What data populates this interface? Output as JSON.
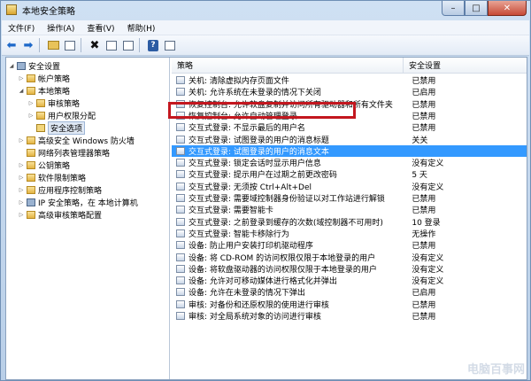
{
  "window": {
    "title": "本地安全策略",
    "controls": {
      "min": "–",
      "max": "□",
      "close": "✕"
    }
  },
  "menu": {
    "items": [
      "文件(F)",
      "操作(A)",
      "查看(V)",
      "帮助(H)"
    ]
  },
  "toolbar": {
    "icons": [
      "back-arrow-icon",
      "forward-arrow-icon",
      "folder-up-icon",
      "show-tree-icon",
      "delete-icon",
      "properties-icon",
      "export-icon",
      "help-icon",
      "view-icon"
    ],
    "help_glyph": "?"
  },
  "tree": {
    "items": [
      {
        "label": "安全设置",
        "level": 0,
        "expander": "◢",
        "icon": "computer-icon"
      },
      {
        "label": "帐户策略",
        "level": 1,
        "expander": "▷",
        "icon": "folder-icon"
      },
      {
        "label": "本地策略",
        "level": 1,
        "expander": "◢",
        "icon": "folder-icon"
      },
      {
        "label": "审核策略",
        "level": 2,
        "expander": "▷",
        "icon": "folder-icon"
      },
      {
        "label": "用户权限分配",
        "level": 2,
        "expander": "▷",
        "icon": "folder-icon"
      },
      {
        "label": "安全选项",
        "level": 2,
        "expander": "",
        "icon": "folder-open-icon",
        "selected": true
      },
      {
        "label": "高级安全 Windows 防火墙",
        "level": 1,
        "expander": "▷",
        "icon": "folder-icon"
      },
      {
        "label": "网络列表管理器策略",
        "level": 1,
        "expander": "",
        "icon": "folder-icon"
      },
      {
        "label": "公钥策略",
        "level": 1,
        "expander": "▷",
        "icon": "folder-icon"
      },
      {
        "label": "软件限制策略",
        "level": 1,
        "expander": "▷",
        "icon": "folder-icon"
      },
      {
        "label": "应用程序控制策略",
        "level": 1,
        "expander": "▷",
        "icon": "folder-icon"
      },
      {
        "label": "IP 安全策略，在 本地计算机",
        "level": 1,
        "expander": "▷",
        "icon": "computer-icon"
      },
      {
        "label": "高级审核策略配置",
        "level": 1,
        "expander": "▷",
        "icon": "folder-icon"
      }
    ]
  },
  "list": {
    "columns": [
      "策略",
      "安全设置"
    ],
    "rows": [
      {
        "policy": "关机: 清除虚拟内存页面文件",
        "setting": "已禁用"
      },
      {
        "policy": "关机: 允许系统在未登录的情况下关闭",
        "setting": "已启用"
      },
      {
        "policy": "恢复控制台: 允许软盘复制并访问所有驱动器和所有文件夹",
        "setting": "已禁用"
      },
      {
        "policy": "恢复控制台: 允许自动管理登录",
        "setting": "已禁用"
      },
      {
        "policy": "交互式登录: 不显示最后的用户名",
        "setting": "已禁用"
      },
      {
        "policy": "交互式登录: 试图登录的用户的消息标题",
        "setting": "关关"
      },
      {
        "policy": "交互式登录: 试图登录的用户的消息文本",
        "setting": "",
        "selected": true
      },
      {
        "policy": "交互式登录: 锁定会话时显示用户信息",
        "setting": "没有定义"
      },
      {
        "policy": "交互式登录: 提示用户在过期之前更改密码",
        "setting": "5 天"
      },
      {
        "policy": "交互式登录: 无须按 Ctrl+Alt+Del",
        "setting": "没有定义"
      },
      {
        "policy": "交互式登录: 需要域控制器身份验证以对工作站进行解锁",
        "setting": "已禁用"
      },
      {
        "policy": "交互式登录: 需要智能卡",
        "setting": "已禁用"
      },
      {
        "policy": "交互式登录: 之前登录到缓存的次数(域控制器不可用时)",
        "setting": "10 登录"
      },
      {
        "policy": "交互式登录: 智能卡移除行为",
        "setting": "无操作"
      },
      {
        "policy": "设备: 防止用户安装打印机驱动程序",
        "setting": "已禁用"
      },
      {
        "policy": "设备: 将 CD-ROM 的访问权限仅限于本地登录的用户",
        "setting": "没有定义"
      },
      {
        "policy": "设备: 将软盘驱动器的访问权限仅限于本地登录的用户",
        "setting": "没有定义"
      },
      {
        "policy": "设备: 允许对可移动媒体进行格式化并弹出",
        "setting": "没有定义"
      },
      {
        "policy": "设备: 允许在未登录的情况下弹出",
        "setting": "已启用"
      },
      {
        "policy": "审核: 对备份和还原权限的使用进行审核",
        "setting": "已禁用"
      },
      {
        "policy": "审核: 对全局系统对象的访问进行审核",
        "setting": "已禁用"
      }
    ]
  },
  "watermark": {
    "text": "电脑百事网"
  }
}
